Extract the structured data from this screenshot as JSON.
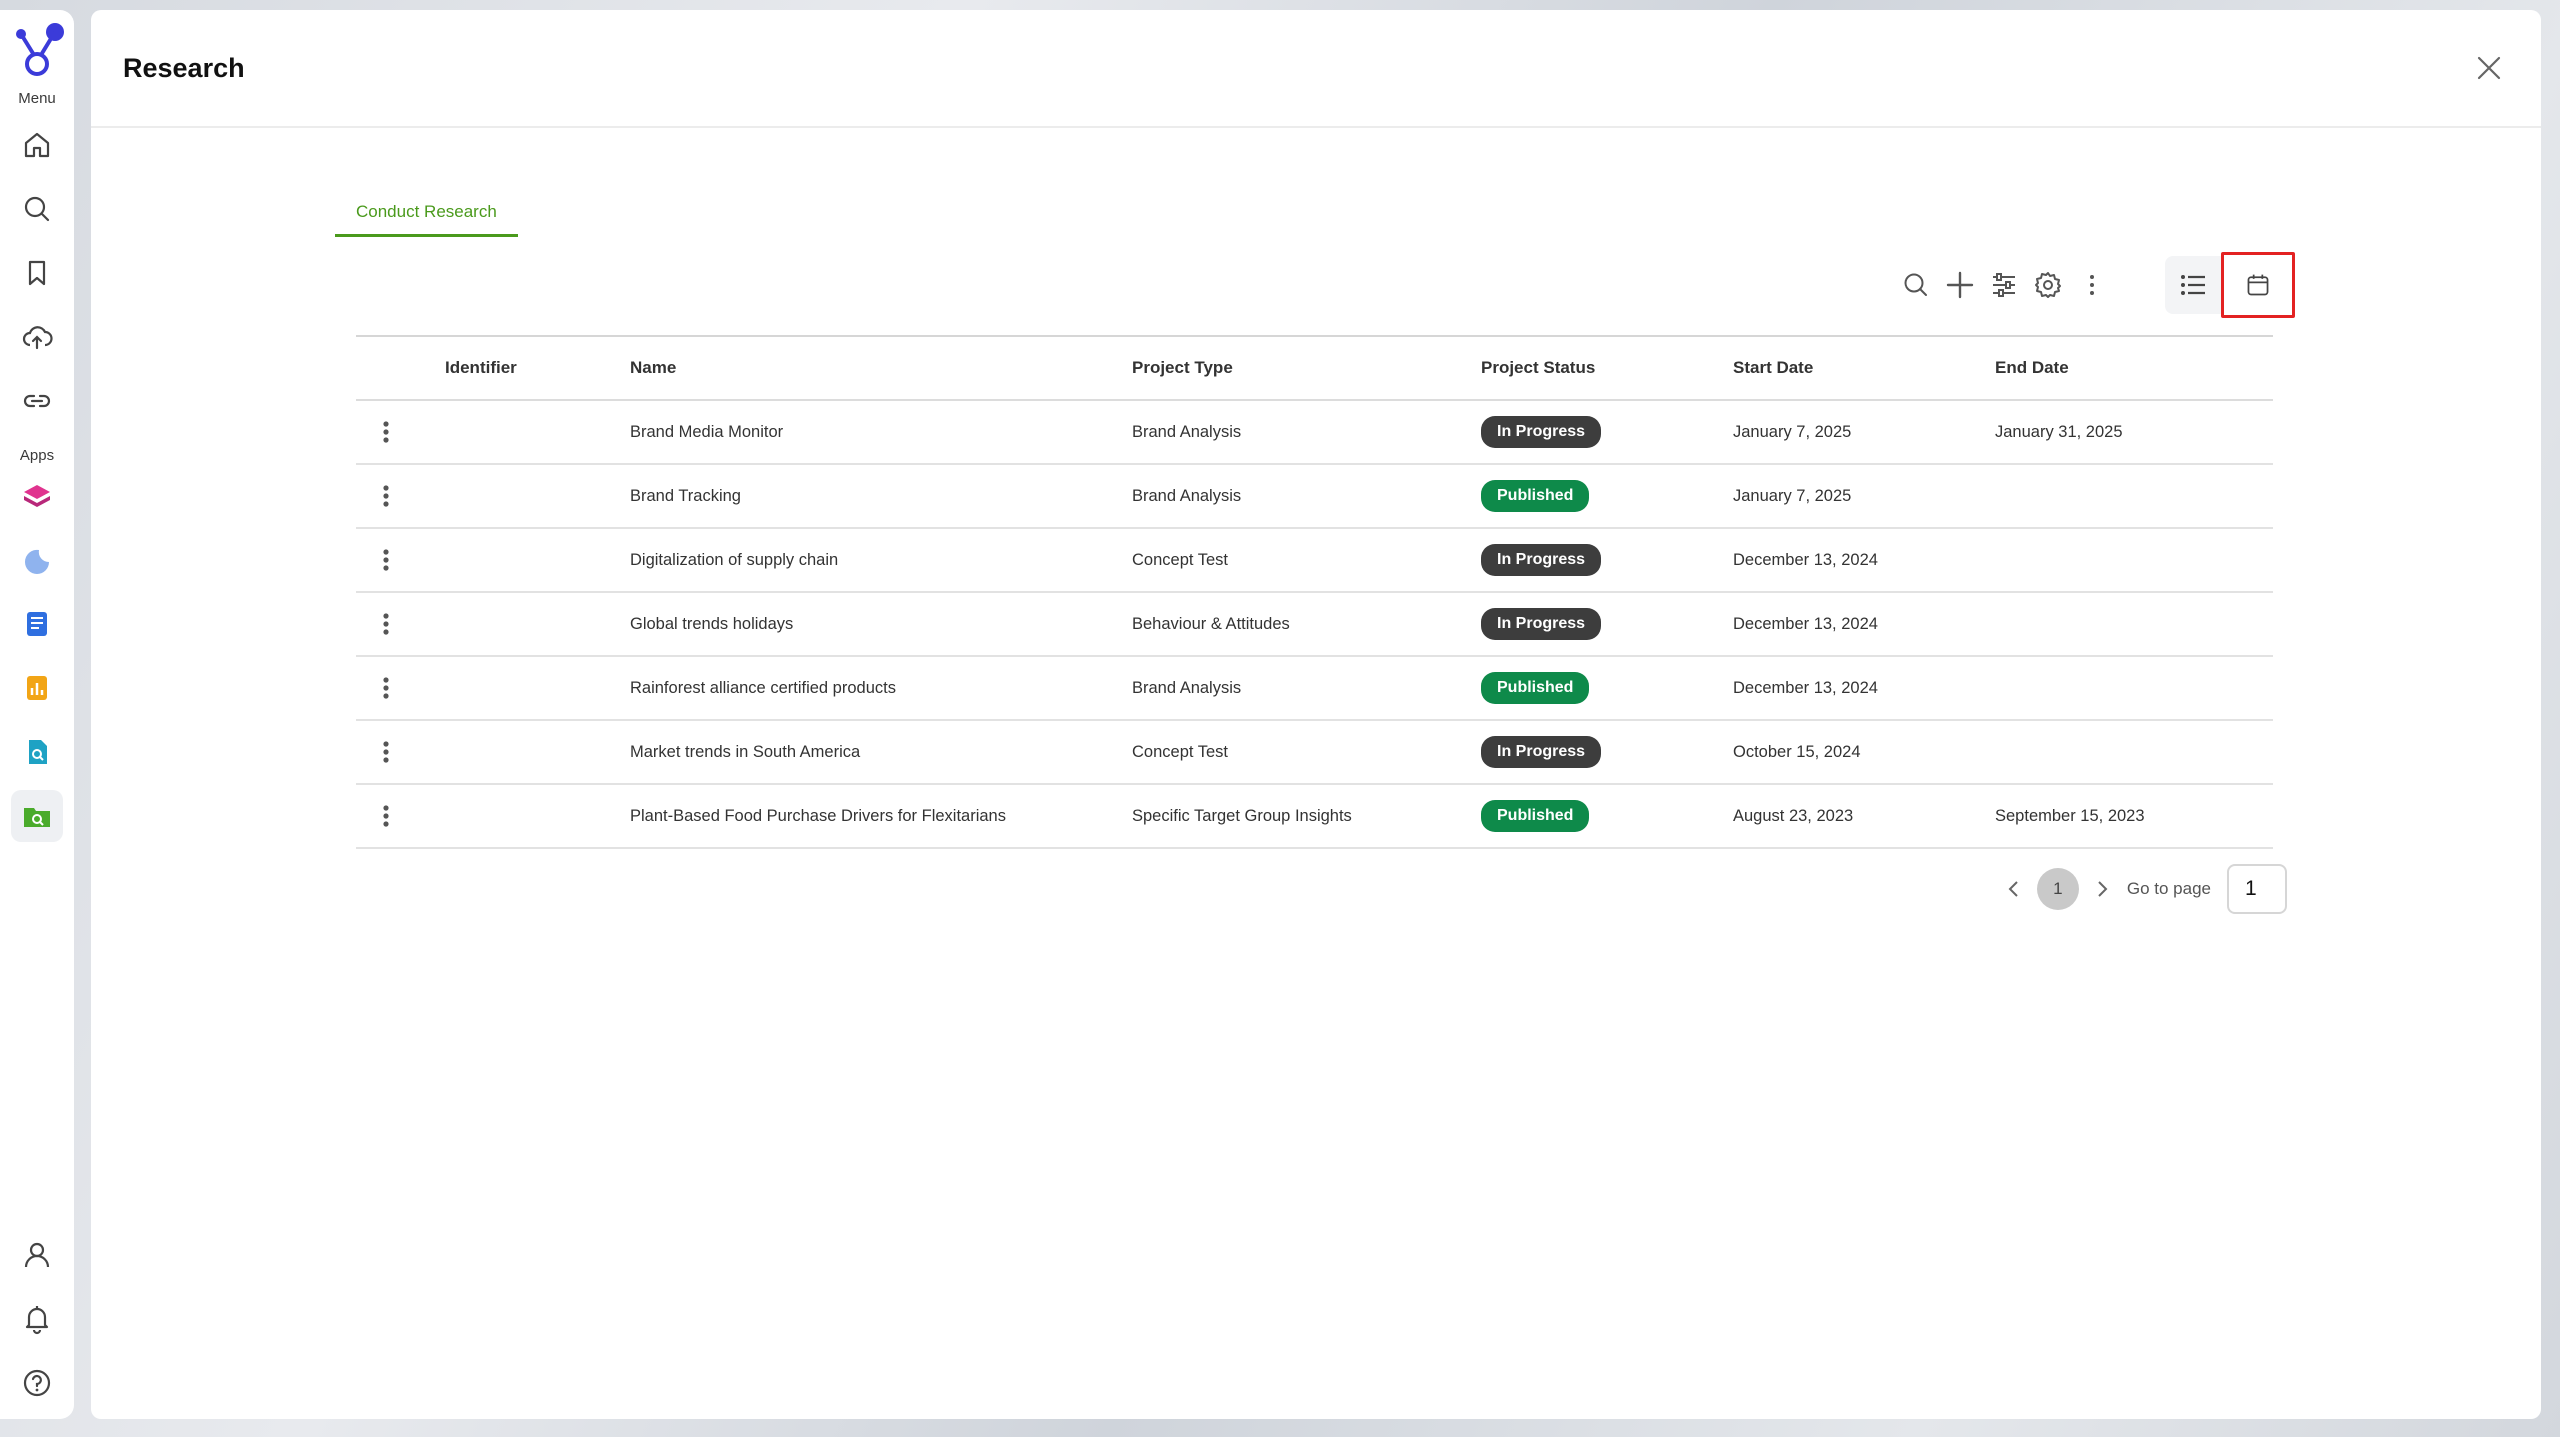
{
  "rail": {
    "menu_label": "Menu",
    "apps_label": "Apps",
    "menu_items": [
      "home-icon",
      "search-icon",
      "bookmark-icon",
      "cloud-upload-icon",
      "link-icon"
    ],
    "app_items": [
      "app-cube-icon",
      "app-wave-icon",
      "app-document-icon",
      "app-chart-icon",
      "app-doc-search-icon",
      "app-folder-search-icon"
    ],
    "bottom_items": [
      "user-icon",
      "bell-icon",
      "help-icon"
    ]
  },
  "panel": {
    "title": "Research"
  },
  "tabs": [
    {
      "label": "Conduct Research",
      "active": true
    }
  ],
  "table": {
    "columns": [
      "Identifier",
      "Name",
      "Project Type",
      "Project Status",
      "Start Date",
      "End Date"
    ],
    "rows": [
      {
        "identifier": "",
        "name": "Brand Media Monitor",
        "type": "Brand Analysis",
        "status": "In Progress",
        "start": "January 7, 2025",
        "end": "January 31, 2025"
      },
      {
        "identifier": "",
        "name": "Brand Tracking",
        "type": "Brand Analysis",
        "status": "Published",
        "start": "January 7, 2025",
        "end": ""
      },
      {
        "identifier": "",
        "name": "Digitalization of supply chain",
        "type": "Concept Test",
        "status": "In Progress",
        "start": "December 13, 2024",
        "end": ""
      },
      {
        "identifier": "",
        "name": "Global trends holidays",
        "type": "Behaviour & Attitudes",
        "status": "In Progress",
        "start": "December 13, 2024",
        "end": ""
      },
      {
        "identifier": "",
        "name": "Rainforest alliance certified products",
        "type": "Brand Analysis",
        "status": "Published",
        "start": "December 13, 2024",
        "end": ""
      },
      {
        "identifier": "",
        "name": "Market trends in South America",
        "type": "Concept Test",
        "status": "In Progress",
        "start": "October 15, 2024",
        "end": ""
      },
      {
        "identifier": "",
        "name": "Plant-Based Food Purchase Drivers for Flexitarians",
        "type": "Specific Target Group Insights",
        "status": "Published",
        "start": "August 23, 2023",
        "end": "September 15, 2023"
      }
    ]
  },
  "pagination": {
    "current_page": "1",
    "goto_label": "Go to page",
    "goto_value": "1"
  },
  "colors": {
    "accent_green": "#4a9a1c",
    "in_progress": "#3d3d3d",
    "published": "#0e8a4a",
    "highlight_box": "#e32222",
    "logo": "#3b3bd9"
  }
}
